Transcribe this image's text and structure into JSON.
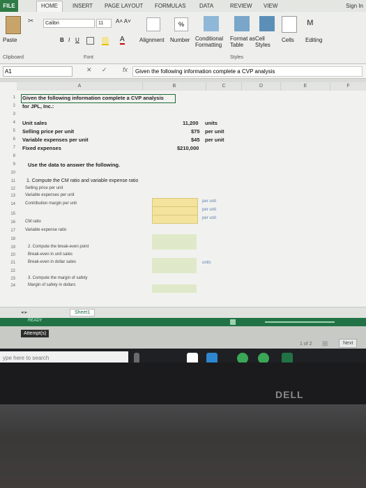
{
  "ribbon": {
    "tabs": [
      "FILE",
      "HOME",
      "INSERT",
      "PAGE LAYOUT",
      "FORMULAS",
      "DATA",
      "REVIEW",
      "VIEW"
    ],
    "sign_in": "Sign In",
    "font_name": "Calibri",
    "font_size": "11",
    "paste": "Paste",
    "bold": "B",
    "italic": "I",
    "underline": "U",
    "alignment": "Alignment",
    "number": "Number",
    "percent": "%",
    "conditional_formatting": "Conditional Formatting",
    "format_as_table": "Format as Table",
    "cell_styles": "Cell Styles",
    "styles_label": "Styles",
    "cells": "Cells",
    "editing": "Editing",
    "clipboard_label": "Clipboard",
    "font_label": "Font"
  },
  "formula_bar": {
    "name_box": "A1",
    "fx": "fx",
    "content": "Given the following information complete a CVP analysis"
  },
  "columns": [
    "A",
    "B",
    "C",
    "D",
    "E",
    "F"
  ],
  "rows": [
    {
      "n": "1",
      "a": "Given the following information complete a CVP analysis",
      "bold": true
    },
    {
      "n": "2",
      "a": "for JPL, Inc.:",
      "bold": true
    },
    {
      "n": "3",
      "a": ""
    },
    {
      "n": "4",
      "a": "Unit sales",
      "b": "11,200",
      "c": "units",
      "bold": true
    },
    {
      "n": "5",
      "a": "Selling price per unit",
      "b": "$75",
      "c": "per unit",
      "bold": true
    },
    {
      "n": "6",
      "a": "Variable expenses per unit",
      "b": "$45",
      "c": "per unit",
      "bold": true
    },
    {
      "n": "7",
      "a": "Fixed expenses",
      "b": "$210,000",
      "bold": true
    },
    {
      "n": "8",
      "a": ""
    },
    {
      "n": "9",
      "a": "Use the data to answer the following.",
      "bold": true
    },
    {
      "n": "10",
      "a": ""
    },
    {
      "n": "11",
      "a": "1. Compute the CM ratio and variable expense ratio"
    },
    {
      "n": "12",
      "a": "Selling price per unit",
      "c": "per unit"
    },
    {
      "n": "13",
      "a": "Variable expenses per unit",
      "c": "per unit"
    },
    {
      "n": "14",
      "a": "Contribution margin per unit",
      "c": "per unit"
    },
    {
      "n": "15",
      "a": ""
    },
    {
      "n": "16",
      "a": "CM ratio"
    },
    {
      "n": "17",
      "a": "Variable expense ratio"
    },
    {
      "n": "18",
      "a": ""
    },
    {
      "n": "19",
      "a": "2. Compute the break-even point"
    },
    {
      "n": "20",
      "a": "Break-even in unit sales",
      "c": "units"
    },
    {
      "n": "21",
      "a": "Break-even in dollar sales"
    },
    {
      "n": "22",
      "a": ""
    },
    {
      "n": "23",
      "a": "3. Compute the margin of safety"
    },
    {
      "n": "24",
      "a": "Margin of safety in dollars"
    }
  ],
  "sheet_tab": "Sheet1",
  "status": "READY",
  "attempt_label": "Attempt(s)",
  "pager": "1 of 2",
  "next": "Next",
  "taskbar_search": "ype here to search",
  "brand": "DELL"
}
